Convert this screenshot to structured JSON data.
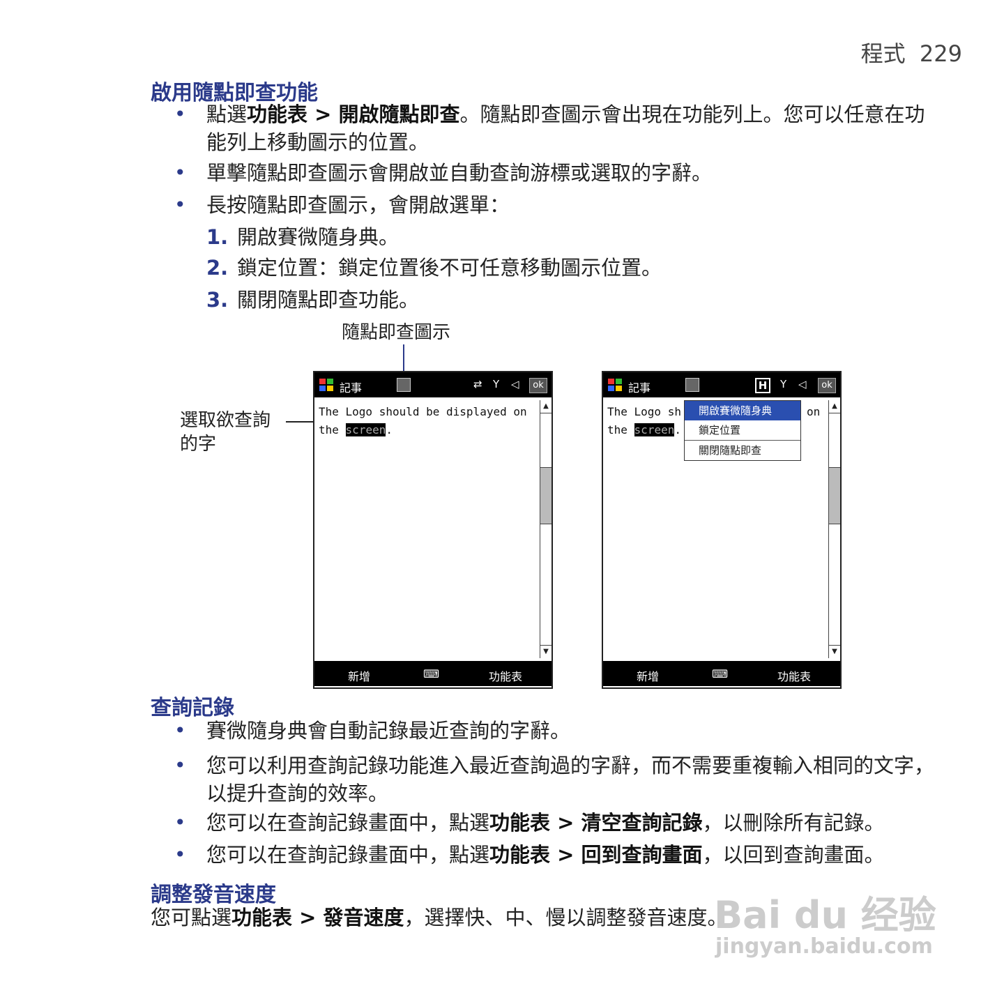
{
  "header": {
    "section": "程式",
    "page": "229"
  },
  "s1": {
    "title": "啟用隨點即查功能",
    "b1": {
      "pre": "點選",
      "bold1": "功能表",
      "gt": " > ",
      "bold2": "開啟隨點即查",
      "post": "。隨點即查圖示會出現在功能列上。您可以任意在功能列上移動圖示的位置。"
    },
    "b2": "單擊隨點即查圖示會開啟並自動查詢游標或選取的字辭。",
    "b3": "長按隨點即查圖示，會開啟選單：",
    "items": [
      {
        "n": "1.",
        "text": "開啟賽微隨身典。"
      },
      {
        "n": "2.",
        "text": "鎖定位置：鎖定位置後不可任意移動圖示位置。"
      },
      {
        "n": "3.",
        "text": "關閉隨點即查功能。"
      }
    ]
  },
  "figure": {
    "cap_icon": "隨點即查圖示",
    "cap_word_1": "選取欲查詢",
    "cap_word_2": "的字",
    "screen": {
      "title": "記事",
      "ok": "ok",
      "text_line1": "The Logo should be displayed on",
      "text_the": "the",
      "text_word": "screen",
      "text_dot": ".",
      "foot_left": "新增",
      "foot_right": "功能表"
    },
    "screen2": {
      "title": "記事",
      "ok": "ok",
      "text_line1a": "The Logo sh",
      "text_on": "on",
      "text_the": "the",
      "text_word": "screen",
      "text_dot": ".",
      "menu": [
        "開啟賽微隨身典",
        "鎖定位置",
        "關閉隨點即查"
      ],
      "foot_left": "新增",
      "foot_right": "功能表"
    }
  },
  "s2": {
    "title": "查詢記錄",
    "b1": "賽微隨身典會自動記錄最近查詢的字辭。",
    "b2": "您可以利用查詢記錄功能進入最近查詢過的字辭，而不需要重複輸入相同的文字，以提升查詢的效率。",
    "b3": {
      "pre": "您可以在查詢記錄畫面中，點選",
      "bold1": "功能表",
      "gt": " > ",
      "bold2": "清空查詢記錄",
      "post": "，以刪除所有記錄。"
    },
    "b4": {
      "pre": "您可以在查詢記錄畫面中，點選",
      "bold1": "功能表",
      "gt": " > ",
      "bold2": "回到查詢畫面",
      "post": "，以回到查詢畫面。"
    }
  },
  "s3": {
    "title": "調整發音速度",
    "p": {
      "pre": "您可點選",
      "bold1": "功能表",
      "gt": " > ",
      "bold2": "發音速度",
      "post": "，選擇快、中、慢以調整發音速度。"
    }
  },
  "watermark": {
    "logo": "Bai du 经验",
    "url": "jingyan.baidu.com"
  }
}
